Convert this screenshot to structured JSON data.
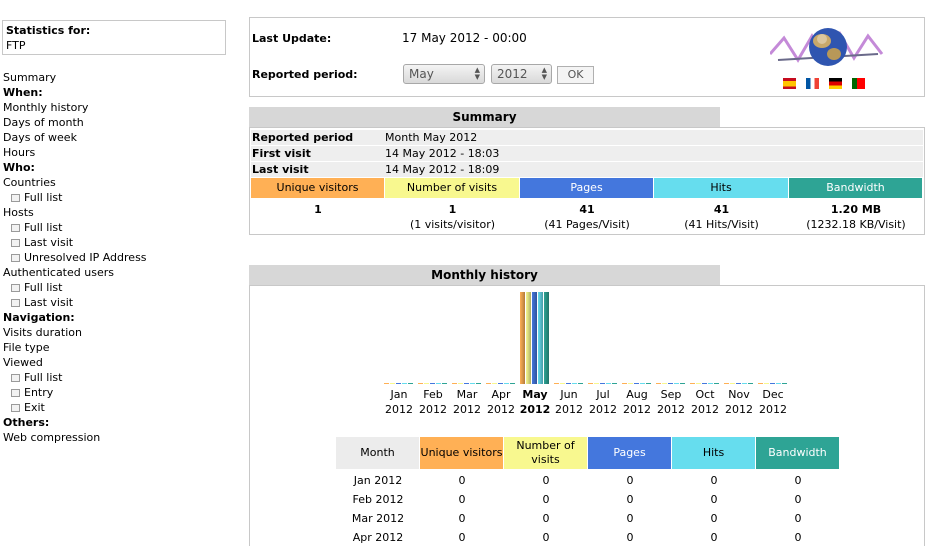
{
  "sidebar": {
    "stats_title": "Statistics for:",
    "stats_site": "FTP",
    "items": [
      {
        "label": "Summary",
        "bold": false,
        "sub": false
      },
      {
        "label": "When:",
        "bold": true,
        "sub": false
      },
      {
        "label": "Monthly history",
        "bold": false,
        "sub": false
      },
      {
        "label": "Days of month",
        "bold": false,
        "sub": false
      },
      {
        "label": "Days of week",
        "bold": false,
        "sub": false
      },
      {
        "label": "Hours",
        "bold": false,
        "sub": false
      },
      {
        "label": "Who:",
        "bold": true,
        "sub": false
      },
      {
        "label": "Countries",
        "bold": false,
        "sub": false
      },
      {
        "label": "Full list",
        "bold": false,
        "sub": true
      },
      {
        "label": "Hosts",
        "bold": false,
        "sub": false
      },
      {
        "label": "Full list",
        "bold": false,
        "sub": true
      },
      {
        "label": "Last visit",
        "bold": false,
        "sub": true
      },
      {
        "label": "Unresolved IP Address",
        "bold": false,
        "sub": true
      },
      {
        "label": "Authenticated users",
        "bold": false,
        "sub": false
      },
      {
        "label": "Full list",
        "bold": false,
        "sub": true
      },
      {
        "label": "Last visit",
        "bold": false,
        "sub": true
      },
      {
        "label": "Navigation:",
        "bold": true,
        "sub": false
      },
      {
        "label": "Visits duration",
        "bold": false,
        "sub": false
      },
      {
        "label": "File type",
        "bold": false,
        "sub": false
      },
      {
        "label": "Viewed",
        "bold": false,
        "sub": false
      },
      {
        "label": "Full list",
        "bold": false,
        "sub": true
      },
      {
        "label": "Entry",
        "bold": false,
        "sub": true
      },
      {
        "label": "Exit",
        "bold": false,
        "sub": true
      },
      {
        "label": "Others:",
        "bold": true,
        "sub": false
      },
      {
        "label": "Web compression",
        "bold": false,
        "sub": false
      }
    ]
  },
  "header": {
    "last_update_label": "Last Update:",
    "last_update_value": "17 May 2012 - 00:00",
    "reported_period_label": "Reported period:",
    "month_select": "May",
    "year_select": "2012",
    "ok_label": "OK",
    "flags": [
      {
        "name": "flag-spain-icon",
        "colors": [
          "#c60b1e",
          "#ffc400",
          "#c60b1e"
        ]
      },
      {
        "name": "flag-france-icon",
        "colors": [
          "#0055a4",
          "#ffffff",
          "#ef4135"
        ]
      },
      {
        "name": "flag-germany-icon",
        "colors": [
          "#000000",
          "#dd0000",
          "#ffce00"
        ]
      },
      {
        "name": "flag-portugal-icon",
        "colors": [
          "#006600",
          "#ff0000",
          "#ff0000"
        ]
      }
    ]
  },
  "summary": {
    "title": "Summary",
    "rows": [
      {
        "key": "Reported period",
        "value": "Month May 2012"
      },
      {
        "key": "First visit",
        "value": "14 May 2012 - 18:03"
      },
      {
        "key": "Last visit",
        "value": "14 May 2012 - 18:09"
      }
    ],
    "columns": [
      {
        "label": "Unique visitors",
        "color": "#ffb055",
        "value": "1",
        "detail": ""
      },
      {
        "label": "Number of visits",
        "color": "#f8f88f",
        "value": "1",
        "detail": "(1 visits/visitor)"
      },
      {
        "label": "Pages",
        "color": "#4477dd",
        "value": "41",
        "detail": "(41 Pages/Visit)"
      },
      {
        "label": "Hits",
        "color": "#66ddee",
        "value": "41",
        "detail": "(41 Hits/Visit)"
      },
      {
        "label": "Bandwidth",
        "color": "#2ea495",
        "value": "1.20 MB",
        "detail": "(1232.18 KB/Visit)"
      }
    ]
  },
  "monthly": {
    "title": "Monthly history",
    "months": [
      {
        "m": "Jan",
        "y": "2012"
      },
      {
        "m": "Feb",
        "y": "2012"
      },
      {
        "m": "Mar",
        "y": "2012"
      },
      {
        "m": "Apr",
        "y": "2012"
      },
      {
        "m": "May",
        "y": "2012"
      },
      {
        "m": "Jun",
        "y": "2012"
      },
      {
        "m": "Jul",
        "y": "2012"
      },
      {
        "m": "Aug",
        "y": "2012"
      },
      {
        "m": "Sep",
        "y": "2012"
      },
      {
        "m": "Oct",
        "y": "2012"
      },
      {
        "m": "Nov",
        "y": "2012"
      },
      {
        "m": "Dec",
        "y": "2012"
      }
    ],
    "current_month_index": 4,
    "table_headers": [
      "Month",
      "Unique visitors",
      "Number of visits",
      "Pages",
      "Hits",
      "Bandwidth"
    ],
    "table_header_colors": [
      "#ececec",
      "#ffb055",
      "#f8f88f",
      "#4477dd",
      "#66ddee",
      "#2ea495"
    ],
    "rows": [
      [
        "Jan 2012",
        "0",
        "0",
        "0",
        "0",
        "0"
      ],
      [
        "Feb 2012",
        "0",
        "0",
        "0",
        "0",
        "0"
      ],
      [
        "Mar 2012",
        "0",
        "0",
        "0",
        "0",
        "0"
      ],
      [
        "Apr 2012",
        "0",
        "0",
        "0",
        "0",
        "0"
      ]
    ]
  },
  "chart_data": {
    "type": "bar",
    "categories": [
      "Jan 2012",
      "Feb 2012",
      "Mar 2012",
      "Apr 2012",
      "May 2012",
      "Jun 2012",
      "Jul 2012",
      "Aug 2012",
      "Sep 2012",
      "Oct 2012",
      "Nov 2012",
      "Dec 2012"
    ],
    "series": [
      {
        "name": "Unique visitors",
        "color": "#ffb055",
        "values": [
          0,
          0,
          0,
          0,
          1,
          0,
          0,
          0,
          0,
          0,
          0,
          0
        ]
      },
      {
        "name": "Number of visits",
        "color": "#f8f88f",
        "values": [
          0,
          0,
          0,
          0,
          1,
          0,
          0,
          0,
          0,
          0,
          0,
          0
        ]
      },
      {
        "name": "Pages",
        "color": "#4477dd",
        "values": [
          0,
          0,
          0,
          0,
          41,
          0,
          0,
          0,
          0,
          0,
          0,
          0
        ]
      },
      {
        "name": "Hits",
        "color": "#66ddee",
        "values": [
          0,
          0,
          0,
          0,
          41,
          0,
          0,
          0,
          0,
          0,
          0,
          0
        ]
      },
      {
        "name": "Bandwidth",
        "color": "#2ea495",
        "values": [
          0,
          0,
          0,
          0,
          1.2,
          0,
          0,
          0,
          0,
          0,
          0,
          0
        ]
      }
    ],
    "series_max": [
      1,
      1,
      41,
      41,
      1.2
    ],
    "title": "Monthly history"
  }
}
